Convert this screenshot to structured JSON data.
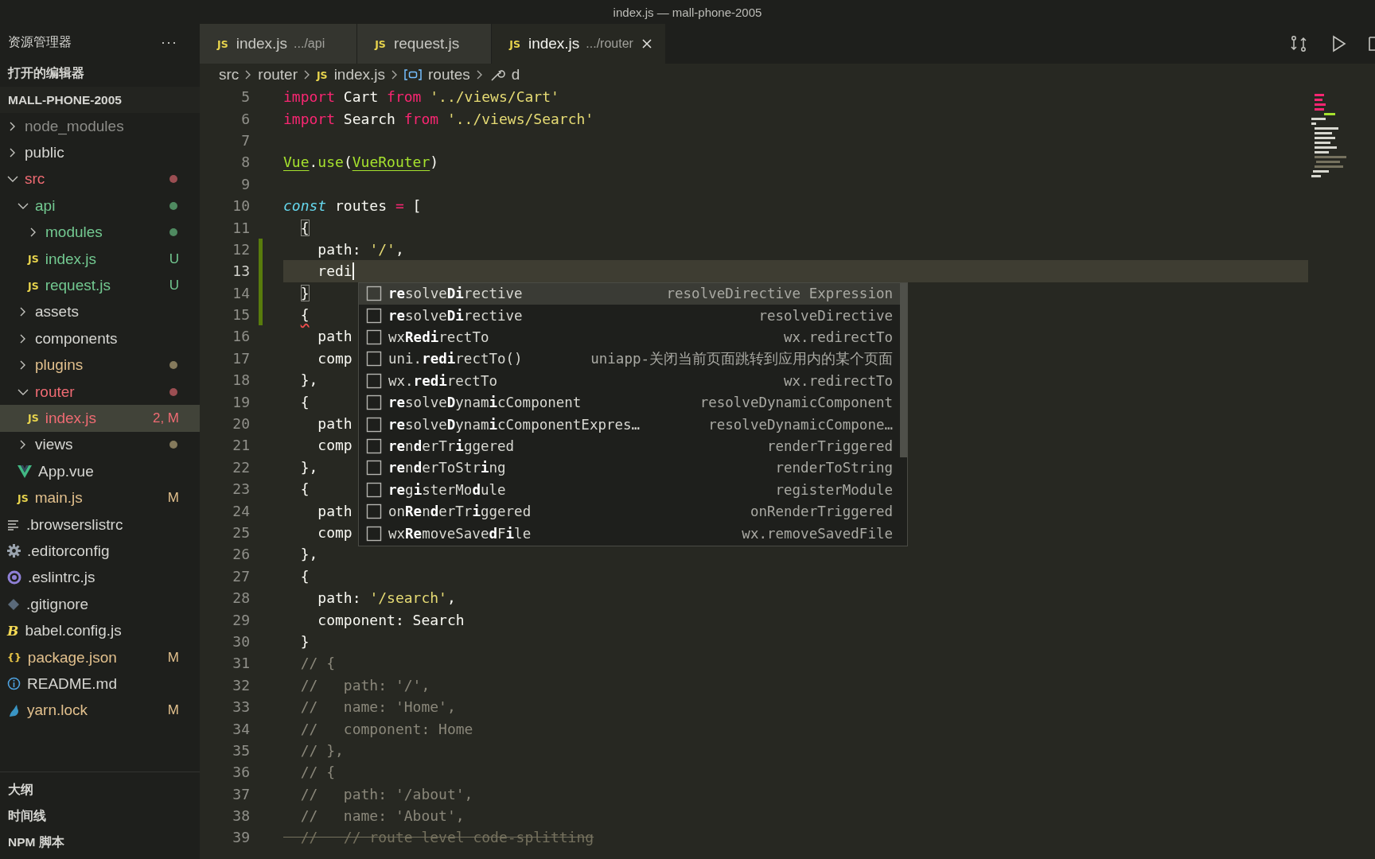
{
  "window": {
    "title": "index.js — mall-phone-2005"
  },
  "sidebar": {
    "title": "资源管理器",
    "more": "···",
    "open_editors": "打开的编辑器",
    "project": "MALL-PHONE-2005",
    "tree": [
      {
        "label": "node_modules",
        "kind": "folder",
        "expanded": false,
        "selected": false,
        "color": "#8c8c88"
      },
      {
        "label": "public",
        "kind": "folder",
        "expanded": false,
        "selected": false,
        "color": "#d6d6d2"
      },
      {
        "label": "src",
        "kind": "folder",
        "expanded": true,
        "selected": false,
        "color": "#ef6b73",
        "dot": {
          "color": "#9b4e52"
        },
        "children": [
          {
            "label": "api",
            "kind": "folder",
            "expanded": true,
            "selected": false,
            "color": "#73c991",
            "dot": {
              "color": "#4f8a60"
            },
            "children": [
              {
                "label": "modules",
                "kind": "folder",
                "expanded": false,
                "selected": false,
                "color": "#73c991",
                "dot": {
                  "color": "#4f8a60"
                }
              },
              {
                "label": "index.js",
                "kind": "js",
                "icon": "JS",
                "selected": false,
                "color": "#73c991",
                "badge": "U"
              },
              {
                "label": "request.js",
                "kind": "js",
                "icon": "JS",
                "selected": false,
                "color": "#73c991",
                "badge": "U"
              }
            ]
          },
          {
            "label": "assets",
            "kind": "folder",
            "expanded": false,
            "selected": false,
            "color": "#d6d6d2"
          },
          {
            "label": "components",
            "kind": "folder",
            "expanded": false,
            "selected": false,
            "color": "#d6d6d2"
          },
          {
            "label": "plugins",
            "kind": "folder",
            "expanded": false,
            "selected": false,
            "color": "#e2c08d",
            "dot": {
              "color": "#857a5c"
            }
          },
          {
            "label": "router",
            "kind": "folder",
            "expanded": true,
            "selected": false,
            "color": "#ef6b73",
            "dot": {
              "color": "#9b4e52"
            },
            "children": [
              {
                "label": "index.js",
                "kind": "js",
                "icon": "JS",
                "selected": true,
                "color": "#ef6b73",
                "badge": "2, M"
              }
            ]
          },
          {
            "label": "views",
            "kind": "folder",
            "expanded": false,
            "selected": false,
            "color": "#d6d6d2",
            "dot": {
              "color": "#857a5c"
            }
          },
          {
            "label": "App.vue",
            "kind": "vue",
            "selected": false,
            "color": "#d6d6d2"
          },
          {
            "label": "main.js",
            "kind": "js",
            "icon": "JS",
            "selected": false,
            "color": "#e2c08d",
            "badge": "M"
          }
        ]
      },
      {
        "label": ".browserslistrc",
        "kind": "lines",
        "selected": false,
        "color": "#d6d6d2"
      },
      {
        "label": ".editorconfig",
        "kind": "gear",
        "selected": false,
        "color": "#d6d6d2"
      },
      {
        "label": ".eslintrc.js",
        "kind": "eslint",
        "selected": false,
        "color": "#d6d6d2"
      },
      {
        "label": ".gitignore",
        "kind": "git",
        "selected": false,
        "color": "#d6d6d2"
      },
      {
        "label": "babel.config.js",
        "kind": "babel",
        "icon": "B",
        "selected": false,
        "color": "#d6d6d2"
      },
      {
        "label": "package.json",
        "kind": "json",
        "icon": "{}",
        "selected": false,
        "color": "#e2c08d",
        "badge": "M"
      },
      {
        "label": "README.md",
        "kind": "info",
        "selected": false,
        "color": "#d6d6d2"
      },
      {
        "label": "yarn.lock",
        "kind": "yarn",
        "selected": false,
        "color": "#e2c08d",
        "badge": "M"
      }
    ],
    "panels": [
      "大纲",
      "时间线",
      "NPM 脚本"
    ]
  },
  "tabs": [
    {
      "icon": "JS",
      "label": "index.js",
      "description": ".../api",
      "selected": false
    },
    {
      "icon": "JS",
      "label": "request.js",
      "selected": false
    },
    {
      "icon": "JS",
      "label": "index.js",
      "description": ".../router",
      "selected": true
    }
  ],
  "breadcrumbs": [
    {
      "label": "src",
      "kind": "folder"
    },
    {
      "label": "router",
      "kind": "folder"
    },
    {
      "label": "index.js",
      "kind": "js",
      "icon": "JS"
    },
    {
      "label": "routes",
      "kind": "variable"
    },
    {
      "label": "d",
      "kind": "property"
    }
  ],
  "editor": {
    "lines": [
      {
        "number": "5",
        "changed": false,
        "current": false,
        "tokens": [
          {
            "text": "import",
            "kind": "keyword"
          },
          {
            "text": " Cart ",
            "kind": "plain"
          },
          {
            "text": "from",
            "kind": "keyword"
          },
          {
            "text": " '../views/Cart'",
            "kind": "string"
          }
        ]
      },
      {
        "number": "6",
        "changed": false,
        "current": false,
        "tokens": [
          {
            "text": "import",
            "kind": "keyword"
          },
          {
            "text": " Search ",
            "kind": "plain"
          },
          {
            "text": "from",
            "kind": "keyword"
          },
          {
            "text": " '../views/Search'",
            "kind": "string"
          }
        ]
      },
      {
        "number": "7",
        "changed": false,
        "current": false
      },
      {
        "number": "8",
        "changed": false,
        "current": false,
        "tokens": [
          {
            "text": "Vue",
            "kind": "class"
          },
          {
            "text": ".",
            "kind": "plain"
          },
          {
            "text": "use",
            "kind": "function"
          },
          {
            "text": "(",
            "kind": "plain"
          },
          {
            "text": "VueRouter",
            "kind": "class"
          },
          {
            "text": ")",
            "kind": "plain"
          }
        ]
      },
      {
        "number": "9",
        "changed": false,
        "current": false
      },
      {
        "number": "10",
        "changed": false,
        "current": false,
        "tokens": [
          {
            "text": "const",
            "kind": "storage"
          },
          {
            "text": " routes ",
            "kind": "plain"
          },
          {
            "text": "=",
            "kind": "keyword"
          },
          {
            "text": " [",
            "kind": "plain"
          }
        ]
      },
      {
        "number": "11",
        "changed": false,
        "current": false,
        "tokens": [
          {
            "text": "  {",
            "kind": "match"
          }
        ]
      },
      {
        "number": "12",
        "changed": true,
        "current": false,
        "tokens": [
          {
            "text": "    path: ",
            "kind": "plain"
          },
          {
            "text": "'/'",
            "kind": "string"
          },
          {
            "text": ",",
            "kind": "plain"
          }
        ]
      },
      {
        "number": "13",
        "changed": true,
        "current": true,
        "tokens": [
          {
            "text": "    redi",
            "kind": "plain"
          }
        ]
      },
      {
        "number": "14",
        "changed": true,
        "current": false,
        "tokens": [
          {
            "text": "  }",
            "kind": "match"
          }
        ]
      },
      {
        "number": "15",
        "changed": true,
        "current": false,
        "tokens": [
          {
            "text": "  {",
            "kind": "error"
          }
        ]
      },
      {
        "number": "16",
        "changed": false,
        "current": false,
        "tokens": [
          {
            "text": "    path",
            "kind": "plain"
          }
        ]
      },
      {
        "number": "17",
        "changed": false,
        "current": false,
        "tokens": [
          {
            "text": "    comp",
            "kind": "plain"
          }
        ]
      },
      {
        "number": "18",
        "changed": false,
        "current": false,
        "tokens": [
          {
            "text": "  },",
            "kind": "plain"
          }
        ]
      },
      {
        "number": "19",
        "changed": false,
        "current": false,
        "tokens": [
          {
            "text": "  {",
            "kind": "plain"
          }
        ]
      },
      {
        "number": "20",
        "changed": false,
        "current": false,
        "tokens": [
          {
            "text": "    path",
            "kind": "plain"
          }
        ]
      },
      {
        "number": "21",
        "changed": false,
        "current": false,
        "tokens": [
          {
            "text": "    comp",
            "kind": "plain"
          }
        ]
      },
      {
        "number": "22",
        "changed": false,
        "current": false,
        "tokens": [
          {
            "text": "  },",
            "kind": "plain"
          }
        ]
      },
      {
        "number": "23",
        "changed": false,
        "current": false,
        "tokens": [
          {
            "text": "  {",
            "kind": "plain"
          }
        ]
      },
      {
        "number": "24",
        "changed": false,
        "current": false,
        "tokens": [
          {
            "text": "    path",
            "kind": "plain"
          }
        ]
      },
      {
        "number": "25",
        "changed": false,
        "current": false,
        "tokens": [
          {
            "text": "    comp",
            "kind": "plain"
          }
        ]
      },
      {
        "number": "26",
        "changed": false,
        "current": false,
        "tokens": [
          {
            "text": "  },",
            "kind": "plain"
          }
        ]
      },
      {
        "number": "27",
        "changed": false,
        "current": false,
        "tokens": [
          {
            "text": "  {",
            "kind": "plain"
          }
        ]
      },
      {
        "number": "28",
        "changed": false,
        "current": false,
        "tokens": [
          {
            "text": "    path: ",
            "kind": "plain"
          },
          {
            "text": "'/search'",
            "kind": "string"
          },
          {
            "text": ",",
            "kind": "plain"
          }
        ]
      },
      {
        "number": "29",
        "changed": false,
        "current": false,
        "tokens": [
          {
            "text": "    component: Search",
            "kind": "plain"
          }
        ]
      },
      {
        "number": "30",
        "changed": false,
        "current": false,
        "tokens": [
          {
            "text": "  }",
            "kind": "plain"
          }
        ]
      },
      {
        "number": "31",
        "changed": false,
        "current": false,
        "tokens": [
          {
            "text": "  // {",
            "kind": "comment"
          }
        ]
      },
      {
        "number": "32",
        "changed": false,
        "current": false,
        "tokens": [
          {
            "text": "  //   path: '/',",
            "kind": "comment"
          }
        ]
      },
      {
        "number": "33",
        "changed": false,
        "current": false,
        "tokens": [
          {
            "text": "  //   name: 'Home',",
            "kind": "comment"
          }
        ]
      },
      {
        "number": "34",
        "changed": false,
        "current": false,
        "tokens": [
          {
            "text": "  //   component: Home",
            "kind": "comment"
          }
        ]
      },
      {
        "number": "35",
        "changed": false,
        "current": false,
        "tokens": [
          {
            "text": "  // },",
            "kind": "comment"
          }
        ]
      },
      {
        "number": "36",
        "changed": false,
        "current": false,
        "tokens": [
          {
            "text": "  // {",
            "kind": "comment"
          }
        ]
      },
      {
        "number": "37",
        "changed": false,
        "current": false,
        "tokens": [
          {
            "text": "  //   path: '/about',",
            "kind": "comment"
          }
        ]
      },
      {
        "number": "38",
        "changed": false,
        "current": false,
        "tokens": [
          {
            "text": "  //   name: 'About',",
            "kind": "comment"
          }
        ]
      },
      {
        "number": "39",
        "changed": false,
        "current": false,
        "tokens": [
          {
            "text": "  //   // route level code-splitting",
            "kind": "deprecated"
          }
        ]
      }
    ]
  },
  "suggest": {
    "items": [
      {
        "label": "**re**solve**Di**rective",
        "detail": "resolveDirective Expression",
        "selected": true
      },
      {
        "label": "**re**solve**Di**rective",
        "detail": "resolveDirective",
        "selected": false
      },
      {
        "label": "wx**Redi**rectTo",
        "detail": "wx.redirectTo",
        "selected": false
      },
      {
        "label": "uni.**redi**rectTo()",
        "detail": "uniapp-关闭当前页面跳转到应用内的某个页面",
        "selected": false
      },
      {
        "label": "wx.**redi**rectTo",
        "detail": "wx.redirectTo",
        "selected": false
      },
      {
        "label": "**re**solve**D**ynam**i**cComponent",
        "detail": "resolveDynamicComponent",
        "selected": false
      },
      {
        "label": "**re**solve**D**ynam**i**cComponentExpres…",
        "detail": "resolveDynamicCompone…",
        "selected": false
      },
      {
        "label": "**re**n**d**erTr**i**ggered",
        "detail": "renderTriggered",
        "selected": false
      },
      {
        "label": "**re**n**d**erToStr**i**ng",
        "detail": "renderToString",
        "selected": false
      },
      {
        "label": "**re**g**i**sterMo**d**ule",
        "detail": "registerModule",
        "selected": false
      },
      {
        "label": "on**Re**n**d**erTr**i**ggered",
        "detail": "onRenderTriggered",
        "selected": false
      },
      {
        "label": "wx**Re**moveSave**d**F**i**le",
        "detail": "wx.removeSavedFile",
        "selected": false
      }
    ]
  }
}
